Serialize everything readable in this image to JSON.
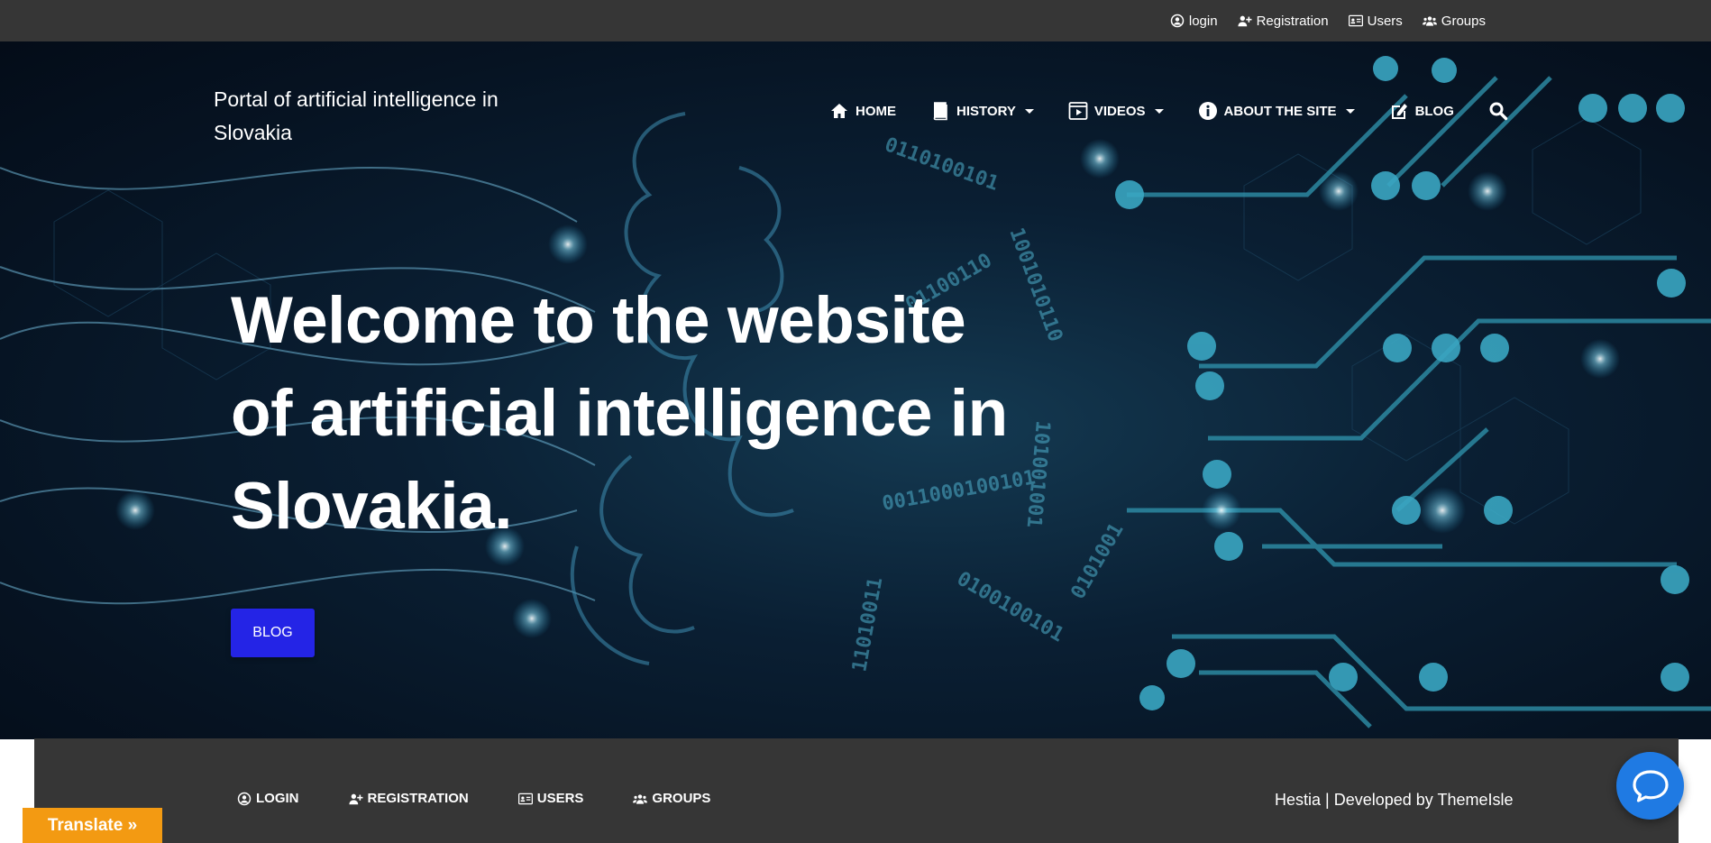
{
  "topbar": {
    "links": [
      {
        "label": "login",
        "icon": "user-circle-icon"
      },
      {
        "label": "Registration",
        "icon": "user-plus-icon"
      },
      {
        "label": "Users",
        "icon": "id-card-icon"
      },
      {
        "label": "Groups",
        "icon": "users-icon"
      }
    ]
  },
  "header": {
    "brand": "Portal of artificial intelligence in Slovakia",
    "nav": [
      {
        "label": "HOME",
        "icon": "home-icon"
      },
      {
        "label": "HISTORY",
        "icon": "book-icon"
      },
      {
        "label": "VIDEOS",
        "icon": "video-icon"
      },
      {
        "label": "ABOUT THE SITE",
        "icon": "info-icon"
      },
      {
        "label": "BLOG",
        "icon": "edit-icon"
      }
    ]
  },
  "hero": {
    "title": "Welcome to the website of artificial intelligence in Slovakia.",
    "button": "BLOG"
  },
  "footer": {
    "links": [
      {
        "label": "LOGIN",
        "icon": "user-circle-icon"
      },
      {
        "label": "REGISTRATION",
        "icon": "user-plus-icon"
      },
      {
        "label": "USERS",
        "icon": "id-card-icon"
      },
      {
        "label": "GROUPS",
        "icon": "users-icon"
      }
    ],
    "credit": "Hestia | Developed by ThemeIsle"
  },
  "widgets": {
    "translate": "Translate »"
  },
  "colors": {
    "topbar": "#363636",
    "accent_button": "#2424e6",
    "translate": "#f39a12",
    "chat": "#1f7ae3"
  }
}
